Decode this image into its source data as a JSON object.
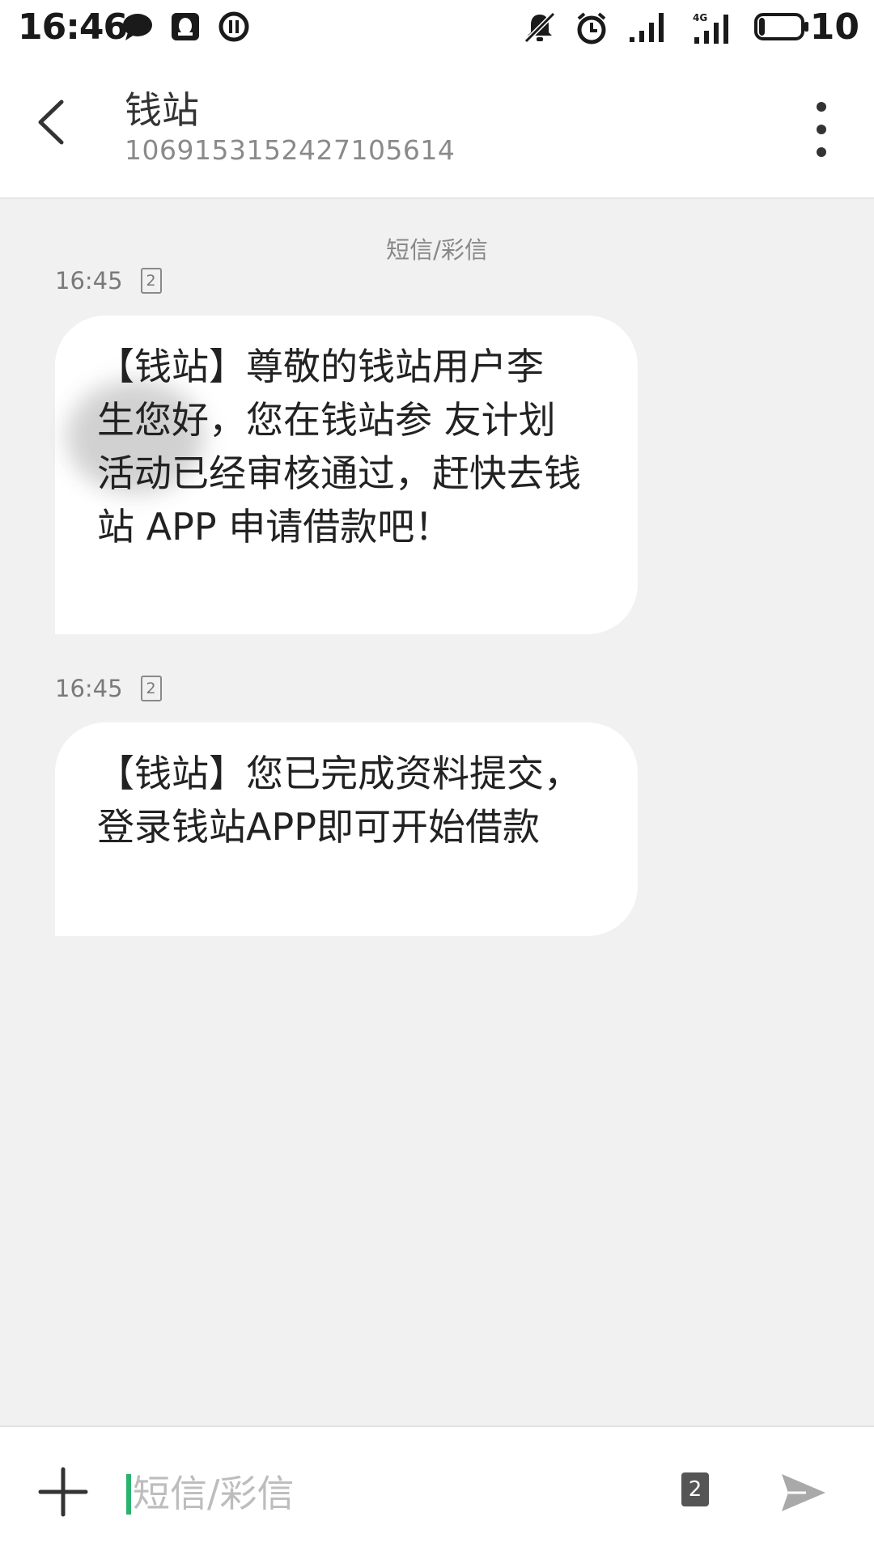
{
  "status_bar": {
    "time": "16:46",
    "battery": "10",
    "icons": [
      "chat-icon",
      "qq-icon",
      "pause-icon",
      "mute-icon",
      "alarm-icon",
      "signal-icon",
      "signal-4g-icon",
      "battery-icon"
    ]
  },
  "header": {
    "contact_name": "钱站",
    "contact_number": "1069153152427105614",
    "back_icon": "chevron-left-icon",
    "more_icon": "more-vertical-icon"
  },
  "conversation": {
    "label": "短信/彩信",
    "messages": [
      {
        "time": "16:45",
        "sim": "2",
        "text": "【钱站】尊敬的钱站用户李 生您好，您在钱站参 友计划活动已经审核通过，赶快去钱站 APP 申请借款吧！"
      },
      {
        "time": "16:45",
        "sim": "2",
        "text": "【钱站】您已完成资料提交，登录钱站APP即可开始借款"
      }
    ]
  },
  "composer": {
    "placeholder": "短信/彩信",
    "sim": "2",
    "add_icon": "plus-icon",
    "send_icon": "send-icon"
  },
  "colors": {
    "background": "#f1f1f1",
    "bubble": "#ffffff",
    "caret": "#2bb36e"
  }
}
